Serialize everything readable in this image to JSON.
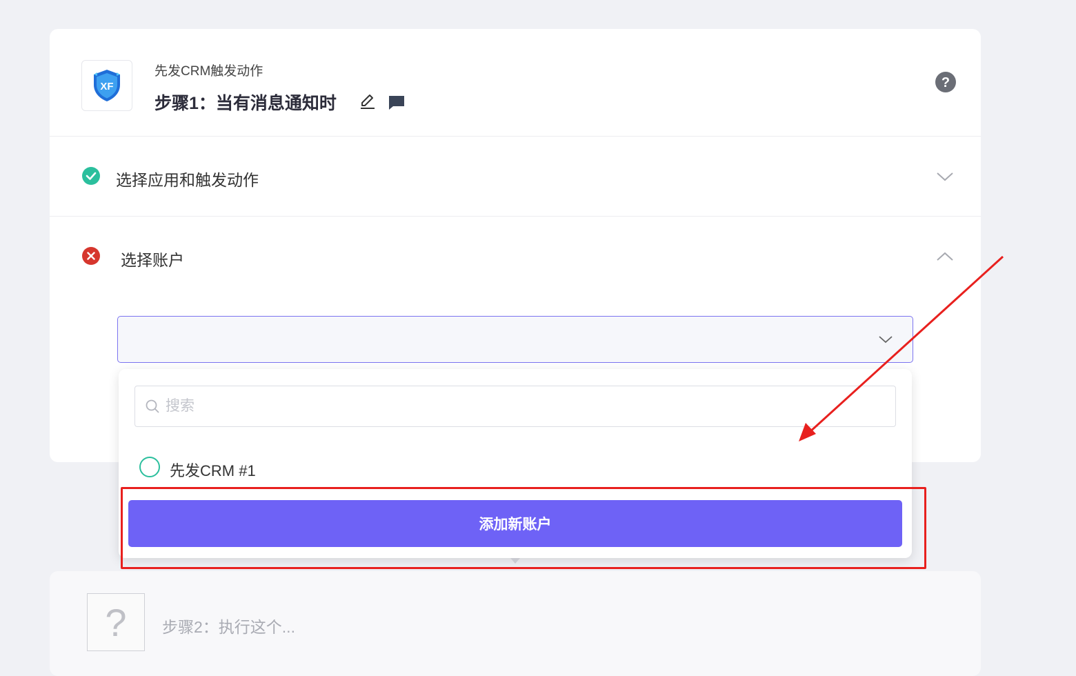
{
  "step1": {
    "app_name": "先发CRM触发动作",
    "title": "步骤1：当有消息通知时",
    "icons": {
      "logo": "xf-shield-logo",
      "edit": "pencil-icon",
      "comment": "comment-icon",
      "help": "help-icon"
    }
  },
  "sections": {
    "app_trigger": {
      "label": "选择应用和触发动作",
      "status": "complete",
      "status_color": "#2bbf9d",
      "expanded": false
    },
    "account": {
      "label": "选择账户",
      "status": "error",
      "status_color": "#d6362d",
      "expanded": true
    }
  },
  "account_select": {
    "value": "",
    "search_placeholder": "搜索",
    "options": [
      {
        "label": "先发CRM #1",
        "selected": false
      }
    ],
    "add_button_label": "添加新账户"
  },
  "step2": {
    "placeholder_glyph": "?",
    "label": "步骤2：执行这个..."
  },
  "colors": {
    "accent": "#6e62f6",
    "annotation": "#e8201e",
    "success": "#2bbf9d",
    "error": "#d6362d"
  }
}
